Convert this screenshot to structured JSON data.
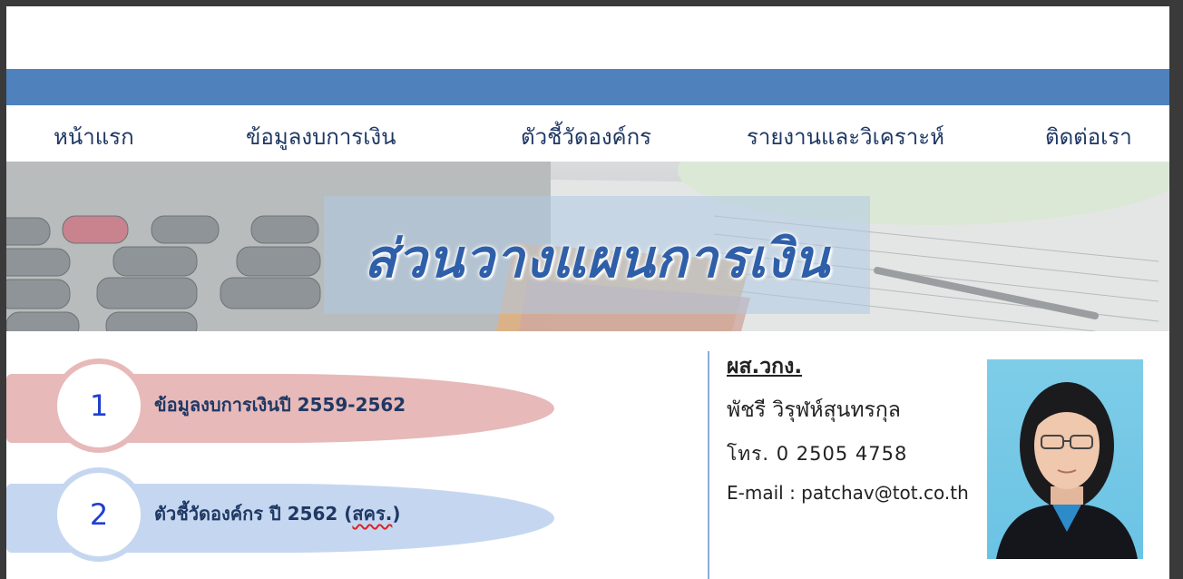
{
  "nav": {
    "items": [
      "หน้าแรก",
      "ข้อมูลงบการเงิน",
      "ตัวชี้วัดองค์กร",
      "รายงานและวิเคราะห์",
      "ติดต่อเรา"
    ]
  },
  "banner": {
    "title": "ส่วนวางแผนการเงิน"
  },
  "menu": [
    {
      "number": "1",
      "label": "ข้อมูลงบการเงินปี 2559-2562"
    },
    {
      "number": "2",
      "label_main": "ตัวชี้วัดองค์กร ปี 2562 (",
      "label_abbr": "สคร.",
      "label_end": ")"
    }
  ],
  "contact": {
    "title": "ผส.วกง.",
    "name": "พัชรี  วิรุฬห์สุนทรกุล",
    "phone": "โทร. 0 2505 4758",
    "email": "E-mail : patchav@tot.co.th"
  },
  "colors": {
    "nav_bar": "#4f81bd",
    "menu_1": "#e7b9b9",
    "menu_2": "#c5d7f0",
    "number_text": "#1f3fd0",
    "nav_text": "#1f3864"
  }
}
